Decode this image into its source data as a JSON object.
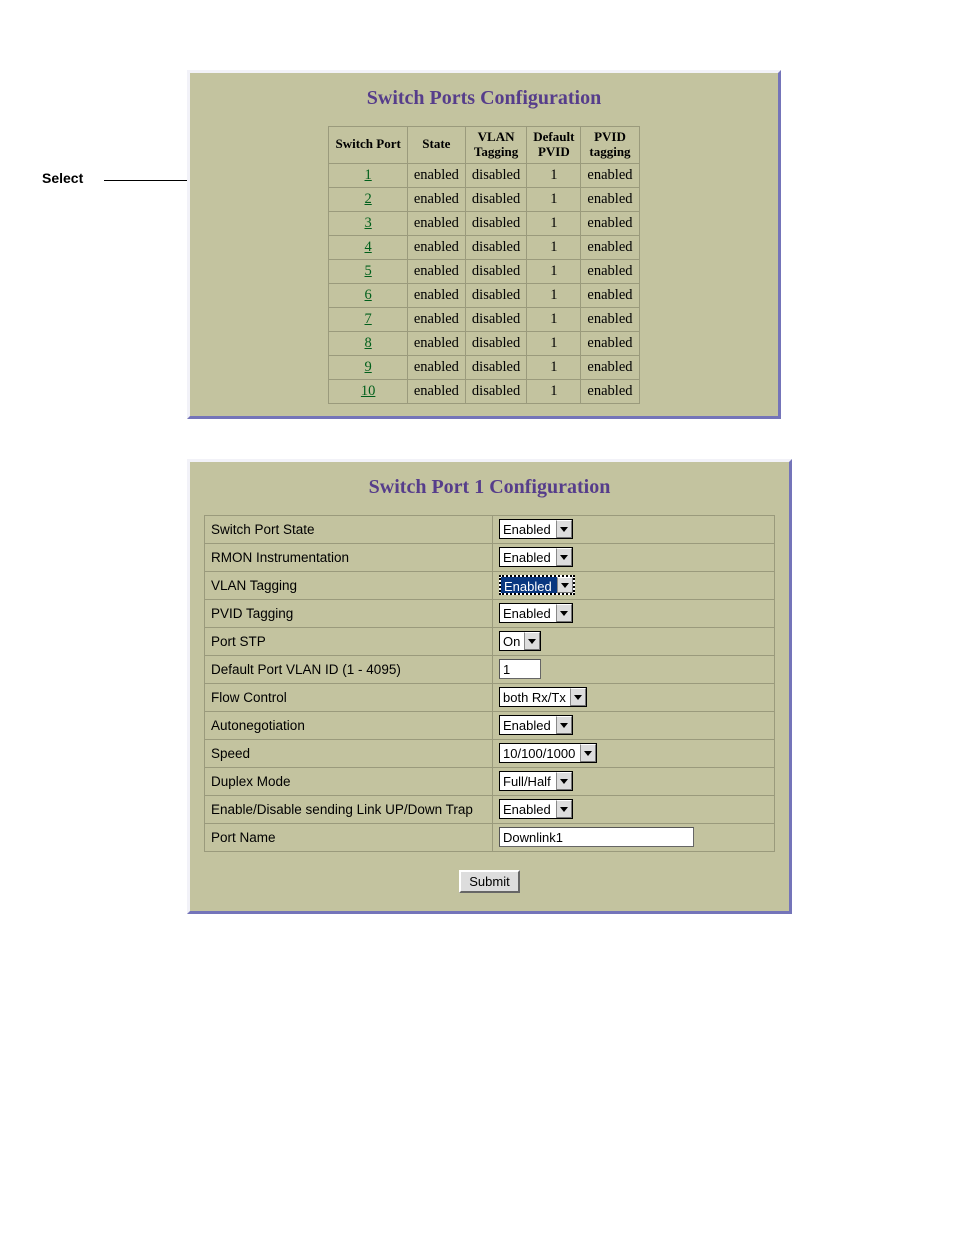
{
  "annotation": {
    "select_label": "Select"
  },
  "ports_panel": {
    "title": "Switch Ports Configuration",
    "columns": {
      "switch_port_a": "Switch Port",
      "state": "State",
      "vlan_a": "VLAN",
      "vlan_b": "Tagging",
      "pvid_a": "Default",
      "pvid_b": "PVID",
      "pvidtag_a": "PVID",
      "pvidtag_b": "tagging"
    },
    "rows": [
      {
        "port": "1",
        "state": "enabled",
        "vlan": "disabled",
        "pvid": "1",
        "pvidtag": "enabled"
      },
      {
        "port": "2",
        "state": "enabled",
        "vlan": "disabled",
        "pvid": "1",
        "pvidtag": "enabled"
      },
      {
        "port": "3",
        "state": "enabled",
        "vlan": "disabled",
        "pvid": "1",
        "pvidtag": "enabled"
      },
      {
        "port": "4",
        "state": "enabled",
        "vlan": "disabled",
        "pvid": "1",
        "pvidtag": "enabled"
      },
      {
        "port": "5",
        "state": "enabled",
        "vlan": "disabled",
        "pvid": "1",
        "pvidtag": "enabled"
      },
      {
        "port": "6",
        "state": "enabled",
        "vlan": "disabled",
        "pvid": "1",
        "pvidtag": "enabled"
      },
      {
        "port": "7",
        "state": "enabled",
        "vlan": "disabled",
        "pvid": "1",
        "pvidtag": "enabled"
      },
      {
        "port": "8",
        "state": "enabled",
        "vlan": "disabled",
        "pvid": "1",
        "pvidtag": "enabled"
      },
      {
        "port": "9",
        "state": "enabled",
        "vlan": "disabled",
        "pvid": "1",
        "pvidtag": "enabled"
      },
      {
        "port": "10",
        "state": "enabled",
        "vlan": "disabled",
        "pvid": "1",
        "pvidtag": "enabled"
      }
    ]
  },
  "config_panel": {
    "title": "Switch Port 1 Configuration",
    "fields": {
      "switch_port_state": {
        "label": "Switch Port State",
        "value": "Enabled"
      },
      "rmon": {
        "label": "RMON Instrumentation",
        "value": "Enabled"
      },
      "vlan_tagging": {
        "label": "VLAN Tagging",
        "value": "Enabled"
      },
      "pvid_tagging": {
        "label": "PVID Tagging",
        "value": "Enabled"
      },
      "port_stp": {
        "label": "Port STP",
        "value": "On"
      },
      "default_vlan_id": {
        "label": "Default Port VLAN ID (1 - 4095)",
        "value": "1"
      },
      "flow_control": {
        "label": "Flow Control",
        "value": "both Rx/Tx"
      },
      "autonegotiation": {
        "label": "Autonegotiation",
        "value": "Enabled"
      },
      "speed": {
        "label": "Speed",
        "value": "10/100/1000"
      },
      "duplex_mode": {
        "label": "Duplex Mode",
        "value": "Full/Half"
      },
      "link_trap": {
        "label": "Enable/Disable sending Link UP/Down Trap",
        "value": "Enabled"
      },
      "port_name": {
        "label": "Port Name",
        "value": "Downlink1"
      }
    },
    "submit_label": "Submit"
  }
}
